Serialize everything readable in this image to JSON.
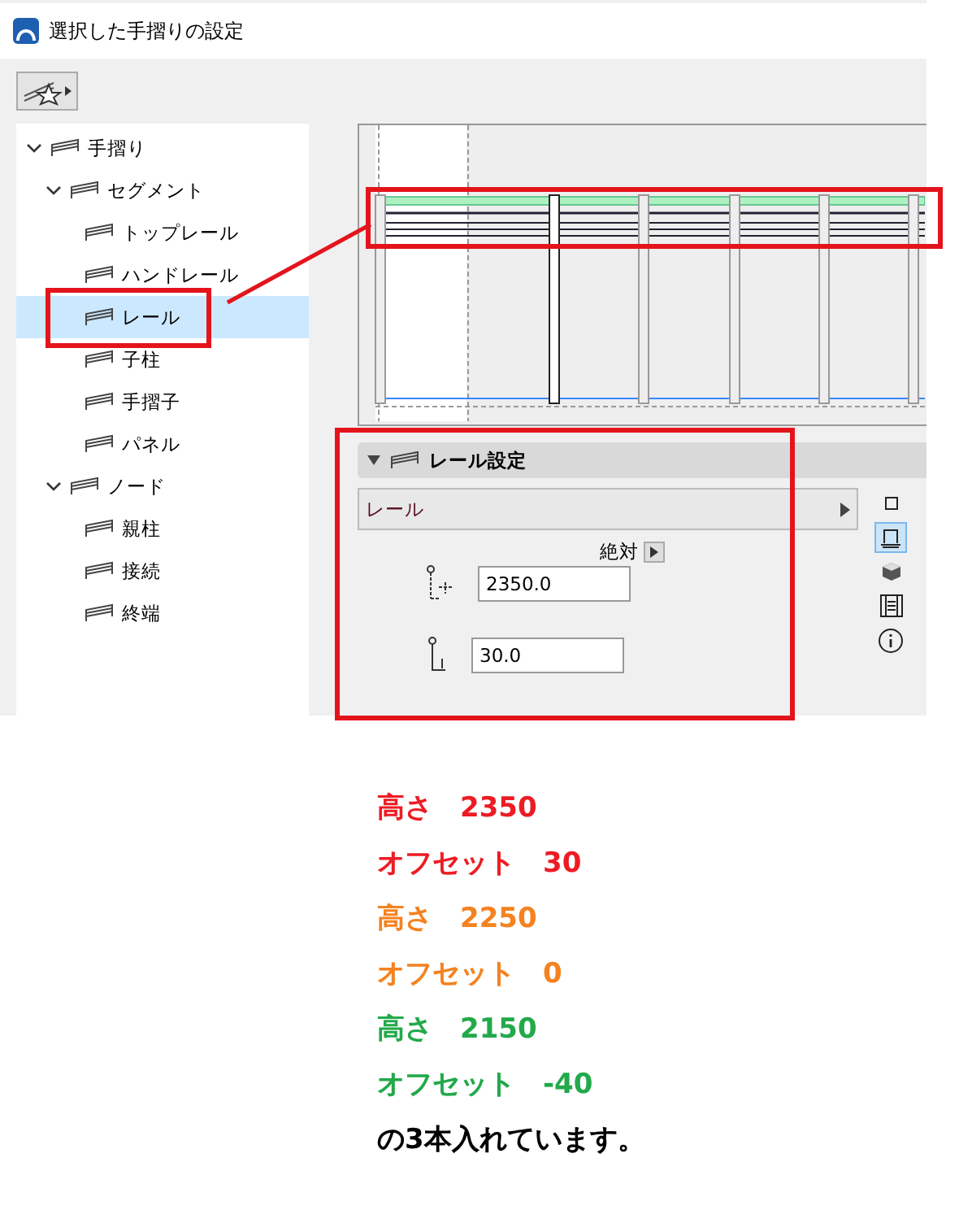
{
  "window": {
    "title": "選択した手摺りの設定"
  },
  "tree": [
    {
      "label": "手摺り",
      "expanded": true,
      "selected": false,
      "children": [
        {
          "label": "セグメント",
          "expanded": true,
          "selected": false,
          "children": [
            {
              "label": "トップレール",
              "selected": false
            },
            {
              "label": "ハンドレール",
              "selected": false
            },
            {
              "label": "レール",
              "selected": true
            },
            {
              "label": "子柱",
              "selected": false
            },
            {
              "label": "手摺子",
              "selected": false
            },
            {
              "label": "パネル",
              "selected": false
            }
          ]
        },
        {
          "label": "ノード",
          "expanded": true,
          "selected": false,
          "children": [
            {
              "label": "親柱",
              "selected": false
            },
            {
              "label": "接続",
              "selected": false
            },
            {
              "label": "終端",
              "selected": false
            }
          ]
        }
      ]
    }
  ],
  "settings": {
    "title": "レール設定",
    "expanded": true,
    "dropdown": "レール",
    "mode": "絶対",
    "fields": [
      {
        "kind": "height",
        "value": "2350.0"
      },
      {
        "kind": "offset",
        "value": "30.0"
      }
    ],
    "side_tools": [
      {
        "kind": "square",
        "selected": false
      },
      {
        "kind": "plan",
        "selected": true
      },
      {
        "kind": "cube",
        "selected": false
      },
      {
        "kind": "film",
        "selected": false
      },
      {
        "kind": "info",
        "selected": false
      }
    ]
  },
  "notes": [
    {
      "text": "高さ　2350",
      "color": "#ed1c24"
    },
    {
      "text": "オフセット　30",
      "color": "#ed1c24"
    },
    {
      "text": "高さ　2250",
      "color": "#f58220"
    },
    {
      "text": "オフセット　0",
      "color": "#f58220"
    },
    {
      "text": "高さ　2150",
      "color": "#22a94a"
    },
    {
      "text": "オフセット　-40",
      "color": "#22a94a"
    },
    {
      "text": "の3本入れています。",
      "color": "#000000"
    }
  ]
}
